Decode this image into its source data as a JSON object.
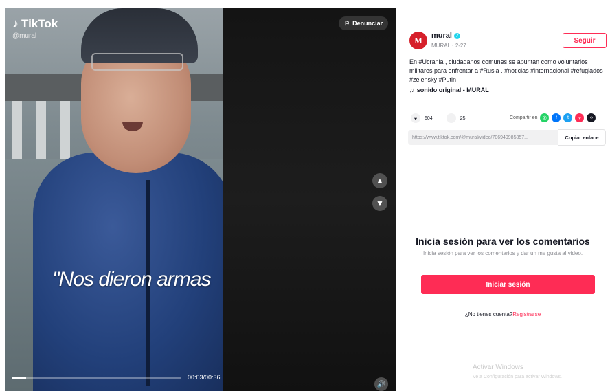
{
  "video": {
    "brand": "TikTok",
    "handle": "@mural",
    "report_label": "Denunciar",
    "subtitle": "\"Nos dieron armas",
    "time": "00:03/00:36",
    "progress": 0.08
  },
  "author": {
    "avatar_letter": "M",
    "name": "mural",
    "subline": "MURAL · 2-27",
    "follow_label": "Seguir"
  },
  "description": {
    "text": "En #Ucrania , ciudadanos comunes se apuntan como voluntarios militares para enfrentar a #Rusia . #noticias #internacional #refugiados #zelensky #Putin",
    "sound": "sonido original - MURAL"
  },
  "stats": {
    "likes": "604",
    "comments": "25",
    "share_label": "Compartir en"
  },
  "link": {
    "url": "https://www.tiktok.com/@mural/video/706949985857...",
    "copy_label": "Copiar enlace"
  },
  "login": {
    "title": "Inicia sesión para ver los comentarios",
    "subtitle": "Inicia sesión para ver los comentarios y dar un me gusta al video.",
    "button_label": "Iniciar sesión",
    "question": "¿No tienes cuenta?",
    "register_label": "Registrarse"
  },
  "windows": {
    "title": "Activar Windows",
    "subtitle": "Ve a Configuración para activar Windows."
  },
  "colors": {
    "accent": "#fe2c55",
    "verified": "#20d5ec"
  }
}
